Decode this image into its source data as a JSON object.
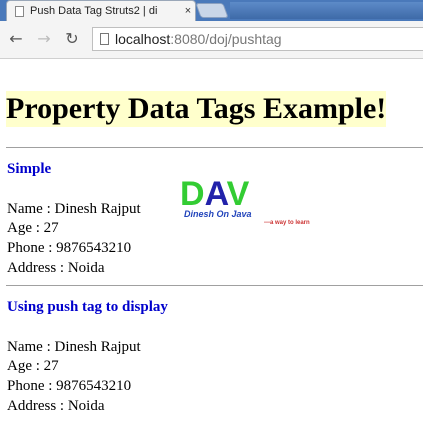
{
  "browser": {
    "tab_title": "Push Data Tag Struts2 | di",
    "tab_close": "×",
    "url_host": "localhost",
    "url_path": ":8080/doj/pushtag"
  },
  "page": {
    "heading": "Property Data Tags Example!",
    "sections": [
      {
        "title": "Simple",
        "lines": [
          "Name : Dinesh Rajput",
          "Age : 27",
          "Phone : 9876543210",
          "Address : Noida"
        ]
      },
      {
        "title": "Using push tag to display",
        "lines": [
          "Name : Dinesh Rajput",
          "Age : 27",
          "Phone : 9876543210",
          "Address : Noida"
        ]
      }
    ],
    "logo": {
      "letters": "DAV",
      "subtitle": "Dinesh On Java",
      "tagline": "---a way to learn",
      "colors": {
        "d": "#33cc33",
        "a": "#2222aa",
        "v": "#33cc33",
        "subtitle": "#2244bb",
        "tagline": "#cc3333"
      }
    }
  }
}
